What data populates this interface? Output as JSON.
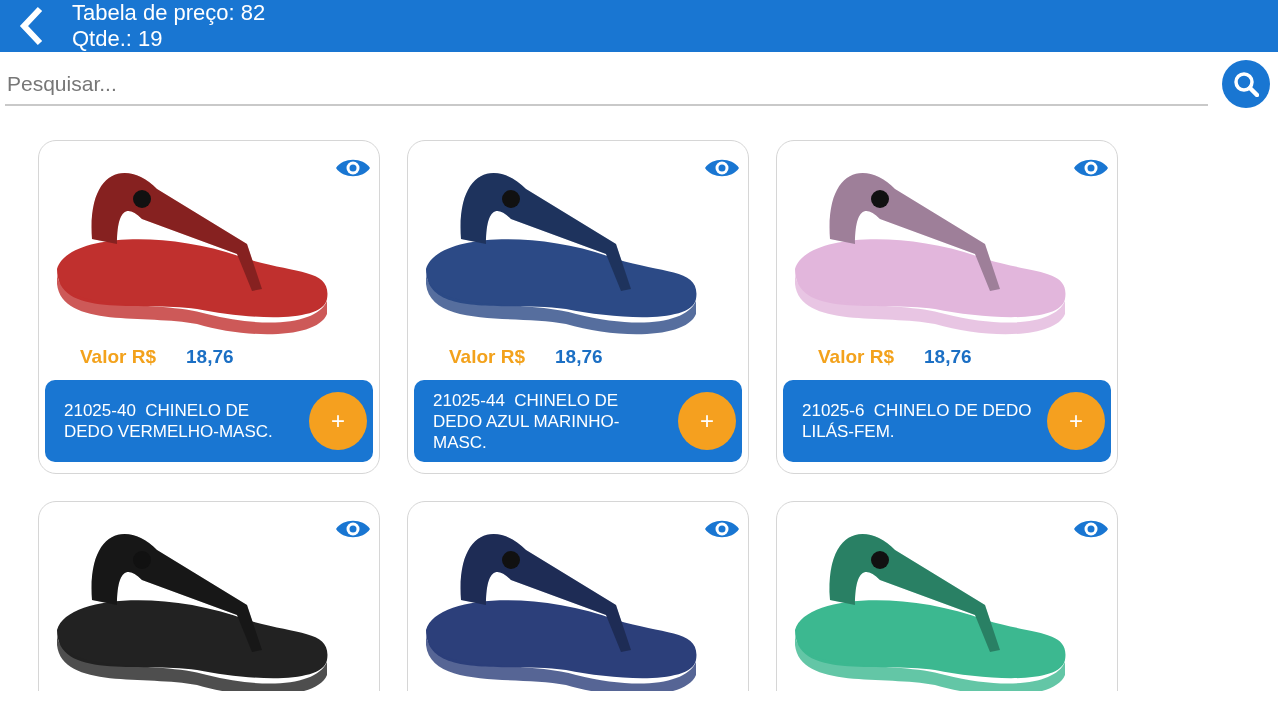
{
  "header": {
    "title": "Tabela de preço: 82",
    "subtitle": "Qtde.: 19"
  },
  "search": {
    "placeholder": "Pesquisar..."
  },
  "products": [
    {
      "color": "#c0302e",
      "price_label": "Valor R$",
      "price": "18,76",
      "name": "21025-40  CHINELO DE DEDO VERMELHO-MASC.",
      "add": "+"
    },
    {
      "color": "#2c4a86",
      "price_label": "Valor R$",
      "price": "18,76",
      "name": "21025-44  CHINELO DE DEDO AZUL MARINHO-MASC.",
      "add": "+"
    },
    {
      "color": "#e2b6dc",
      "price_label": "Valor R$",
      "price": "18,76",
      "name": "21025-6  CHINELO DE DEDO LILÁS-FEM.",
      "add": "+"
    },
    {
      "color": "#222222"
    },
    {
      "color": "#2c3f7a"
    },
    {
      "color": "#3cb890"
    }
  ]
}
